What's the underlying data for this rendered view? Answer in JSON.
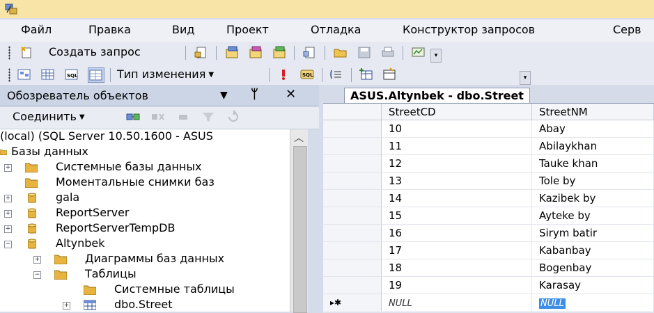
{
  "menu": [
    "Файл",
    "Правка",
    "Вид",
    "Проект",
    "Отладка",
    "Конструктор запросов",
    "Серв"
  ],
  "toolbar1": {
    "new_query": "Создать запрос"
  },
  "toolbar2": {
    "change_type": "Тип изменения"
  },
  "object_explorer": {
    "title": "Обозреватель объектов",
    "pin": "ᛘ",
    "close": "✕",
    "connect": "Соединить",
    "tree": [
      {
        "label": "(local) (SQL Server 10.50.1600 - ASUS",
        "expander": ""
      },
      {
        "label": "Базы данных",
        "expander": ""
      },
      {
        "label": "Системные базы данных",
        "expander": "+"
      },
      {
        "label": "Моментальные снимки баз",
        "expander": ""
      },
      {
        "label": "gala",
        "expander": "+"
      },
      {
        "label": "ReportServer",
        "expander": "+"
      },
      {
        "label": "ReportServerTempDB",
        "expander": "+"
      },
      {
        "label": "Altynbek",
        "expander": "−"
      },
      {
        "label": "Диаграммы баз данных",
        "expander": "+"
      },
      {
        "label": "Таблицы",
        "expander": "−"
      },
      {
        "label": "Системные таблицы",
        "expander": ""
      },
      {
        "label": "dbo.Street",
        "expander": "+"
      }
    ]
  },
  "editor": {
    "tab_title": "ASUS.Altynbek - dbo.Street",
    "columns": [
      "StreetCD",
      "StreetNM"
    ],
    "rows": [
      [
        "10",
        "Abay"
      ],
      [
        "11",
        "Abilaykhan"
      ],
      [
        "12",
        "Tauke khan"
      ],
      [
        "13",
        "Tole by"
      ],
      [
        "14",
        "Kazibek by"
      ],
      [
        "15",
        "Ayteke by"
      ],
      [
        "16",
        "Sirym batir"
      ],
      [
        "17",
        "Kabanbay"
      ],
      [
        "18",
        "Bogenbay"
      ],
      [
        "19",
        "Karasay"
      ]
    ],
    "new_row_marker": "▸✱",
    "null_cd": "NULL",
    "null_nm": "NULL"
  }
}
